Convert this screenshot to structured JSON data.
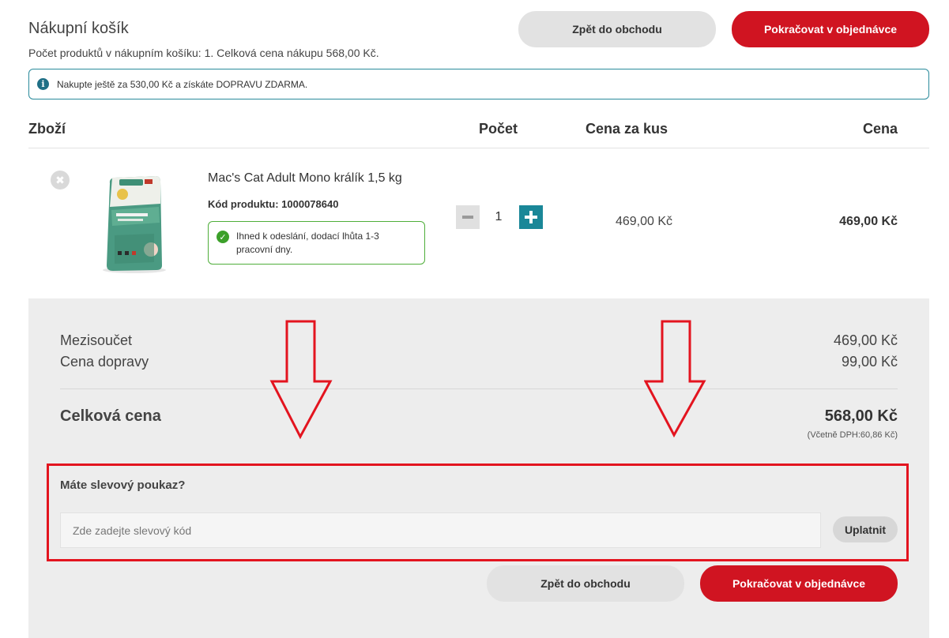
{
  "header": {
    "title": "Nákupní košík",
    "subtitle": "Počet produktů v nákupním košíku: 1. Celková cena nákupu 568,00 Kč.",
    "back_label": "Zpět do obchodu",
    "continue_label": "Pokračovat v objednávce"
  },
  "info": {
    "icon": "info-icon",
    "text": "Nakupte ještě za 530,00 Kč a získáte DOPRAVU ZDARMA."
  },
  "table": {
    "columns": [
      "Zboží",
      "Počet",
      "Cena za kus",
      "Cena"
    ]
  },
  "item": {
    "name": "Mac's Cat Adult Mono králík 1,5 kg",
    "code": "Kód produktu: 1000078640",
    "availability": "Ihned k odeslání, dodací lhůta 1-3 pracovní dny.",
    "quantity": "1",
    "unit_price": "469,00 Kč",
    "total_price": "469,00 Kč"
  },
  "summary": {
    "subtotal_label": "Mezisoučet",
    "subtotal_value": "469,00 Kč",
    "shipping_label": "Cena dopravy",
    "shipping_value": "99,00 Kč",
    "total_label": "Celková cena",
    "total_value": "568,00 Kč",
    "vat_note": "(Včetně DPH:60,86 Kč)"
  },
  "coupon": {
    "title": "Máte slevový poukaz?",
    "placeholder": "Zde zadejte slevový kód",
    "apply_label": "Uplatnit"
  },
  "footer": {
    "back_label": "Zpět do obchodu",
    "continue_label": "Pokračovat v objednávce"
  },
  "colors": {
    "accent_red": "#d01421",
    "teal": "#1a8798",
    "annotation_red": "#e3141f"
  }
}
